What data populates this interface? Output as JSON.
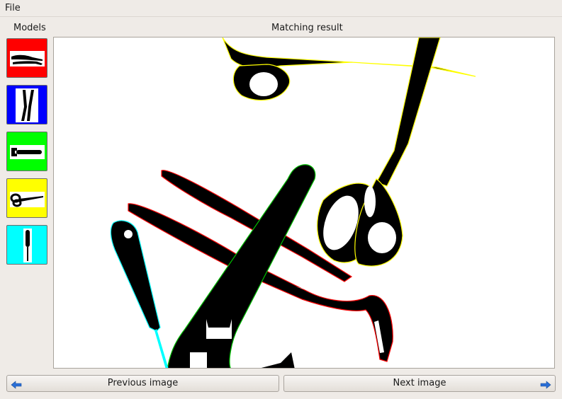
{
  "menu": {
    "file": "File"
  },
  "panels": {
    "models": "Models",
    "matching_result": "Matching result"
  },
  "models": [
    {
      "name": "pliers",
      "color": "#ff0000"
    },
    {
      "name": "cutter",
      "color": "#0000ff"
    },
    {
      "name": "wrench",
      "color": "#00ff00"
    },
    {
      "name": "scissors",
      "color": "#ffff00"
    },
    {
      "name": "screwdriver",
      "color": "#00ffff"
    }
  ],
  "navigation": {
    "previous": "Previous image",
    "next": "Next image",
    "arrow_color": "#2a6fd6"
  },
  "contour_colors": {
    "pliers": "#ff0000",
    "wrench": "#00c000",
    "scissors": "#ffff00",
    "screwdriver": "#00ffff"
  }
}
